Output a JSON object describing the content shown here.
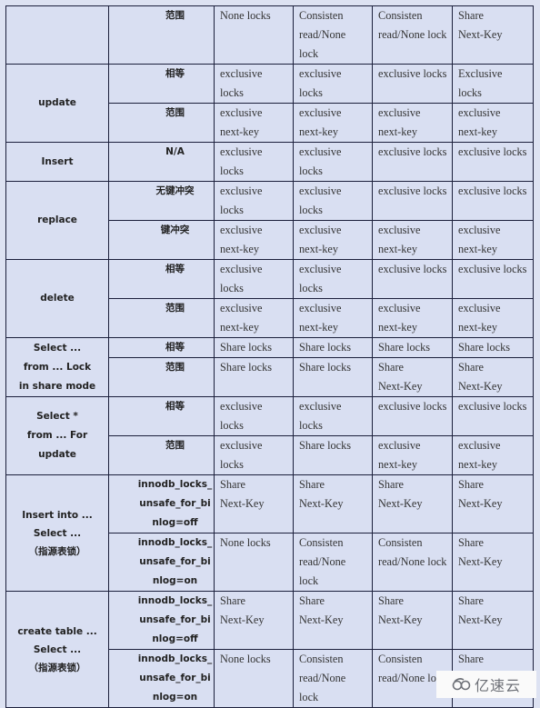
{
  "table": {
    "groups": [
      {
        "op": "",
        "rows": [
          {
            "cond": "范围",
            "cells": [
              "None locks",
              "Consisten\nread/None\nlock",
              "Consisten\nread/None lock",
              "Share\nNext-Key"
            ]
          }
        ]
      },
      {
        "op": "update",
        "rows": [
          {
            "cond": "相等",
            "cells": [
              "exclusive\nlocks",
              "exclusive\nlocks",
              "exclusive locks",
              "Exclusive\nlocks"
            ]
          },
          {
            "cond": "范围",
            "cells": [
              "exclusive\nnext-key",
              "exclusive\nnext-key",
              "exclusive\nnext-key",
              "exclusive\nnext-key"
            ]
          }
        ]
      },
      {
        "op": "Insert",
        "rows": [
          {
            "cond": "N/A",
            "cells": [
              "exclusive\nlocks",
              "exclusive\nlocks",
              "exclusive locks",
              "exclusive locks"
            ]
          }
        ]
      },
      {
        "op": "replace",
        "rows": [
          {
            "cond": "无键冲突",
            "cells": [
              "exclusive\nlocks",
              "exclusive\nlocks",
              "exclusive locks",
              "exclusive locks"
            ]
          },
          {
            "cond": "键冲突",
            "cells": [
              "exclusive\nnext-key",
              "exclusive\nnext-key",
              "exclusive\nnext-key",
              "exclusive\nnext-key"
            ]
          }
        ]
      },
      {
        "op": "delete",
        "rows": [
          {
            "cond": "相等",
            "cells": [
              "exclusive\nlocks",
              "exclusive\nlocks",
              "exclusive locks",
              "exclusive locks"
            ]
          },
          {
            "cond": "范围",
            "cells": [
              "exclusive\nnext-key",
              "exclusive\nnext-key",
              "exclusive\nnext-key",
              "exclusive\nnext-key"
            ]
          }
        ]
      },
      {
        "op": "Select ...\nfrom ... Lock\nin share mode",
        "rows": [
          {
            "cond": "相等",
            "cells": [
              "Share locks",
              "Share locks",
              "Share locks",
              "Share locks"
            ]
          },
          {
            "cond": "范围",
            "cells": [
              "Share locks",
              "Share locks",
              "Share\nNext-Key",
              "Share\nNext-Key"
            ]
          }
        ]
      },
      {
        "op": "Select *\nfrom ... For\nupdate",
        "rows": [
          {
            "cond": "相等",
            "cells": [
              "exclusive\nlocks",
              "exclusive\nlocks",
              "exclusive locks",
              "exclusive locks"
            ]
          },
          {
            "cond": "范围",
            "cells": [
              "exclusive\nlocks",
              "Share locks",
              "exclusive\nnext-key",
              "exclusive\nnext-key"
            ]
          }
        ]
      },
      {
        "op": "Insert into ...\nSelect ...\n（指源表锁）",
        "rows": [
          {
            "cond": "innodb_locks_\nunsafe_for_bi\nnlog=off",
            "cells": [
              "Share\nNext-Key",
              "Share\nNext-Key",
              "Share\nNext-Key",
              "Share\nNext-Key"
            ]
          },
          {
            "cond": "innodb_locks_\nunsafe_for_bi\nnlog=on",
            "cells": [
              "None locks",
              "Consisten\nread/None\nlock",
              "Consisten\nread/None lock",
              "Share\nNext-Key"
            ]
          }
        ]
      },
      {
        "op": "create table ...\nSelect ...\n（指源表锁）",
        "rows": [
          {
            "cond": "innodb_locks_\nunsafe_for_bi\nnlog=off",
            "cells": [
              "Share\nNext-Key",
              "Share\nNext-Key",
              "Share\nNext-Key",
              "Share\nNext-Key"
            ]
          },
          {
            "cond": "innodb_locks_\nunsafe_for_bi\nnlog=on",
            "cells": [
              "None locks",
              "Consisten\nread/None\nlock",
              "Consisten\nread/None lock",
              "Share\nNext-Key"
            ]
          }
        ]
      }
    ]
  },
  "watermark": {
    "text": "亿速云",
    "icon": "yisu-cloud-logo-icon"
  }
}
